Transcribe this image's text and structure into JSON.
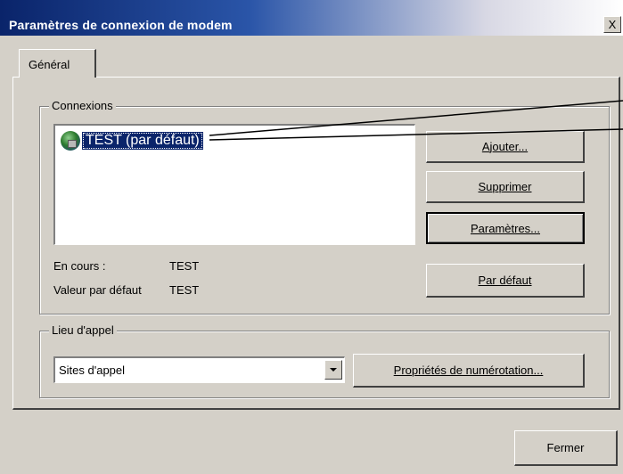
{
  "window": {
    "title": "Paramètres de connexion de modem",
    "close_label": "X"
  },
  "tabs": [
    {
      "label": "Général",
      "active": true
    }
  ],
  "connections": {
    "group_label": "Connexions",
    "items": [
      {
        "label": "TEST (par défaut)",
        "icon": "network-connection-icon",
        "selected": true
      }
    ]
  },
  "buttons": {
    "add": "Ajouter...",
    "remove": "Supprimer",
    "settings": "Paramètres...",
    "set_default": "Par défaut",
    "dialing_properties": "Propriétés de numérotation...",
    "close": "Fermer"
  },
  "status": {
    "current_label": "En cours :",
    "current_value": "TEST",
    "default_label": "Valeur par défaut",
    "default_value": "TEST"
  },
  "dialing": {
    "group_label": "Lieu d'appel",
    "selected": "Sites d'appel"
  },
  "colors": {
    "face": "#d4d0c8",
    "titlebar_start": "#0a246a",
    "selection": "#0a246a"
  }
}
